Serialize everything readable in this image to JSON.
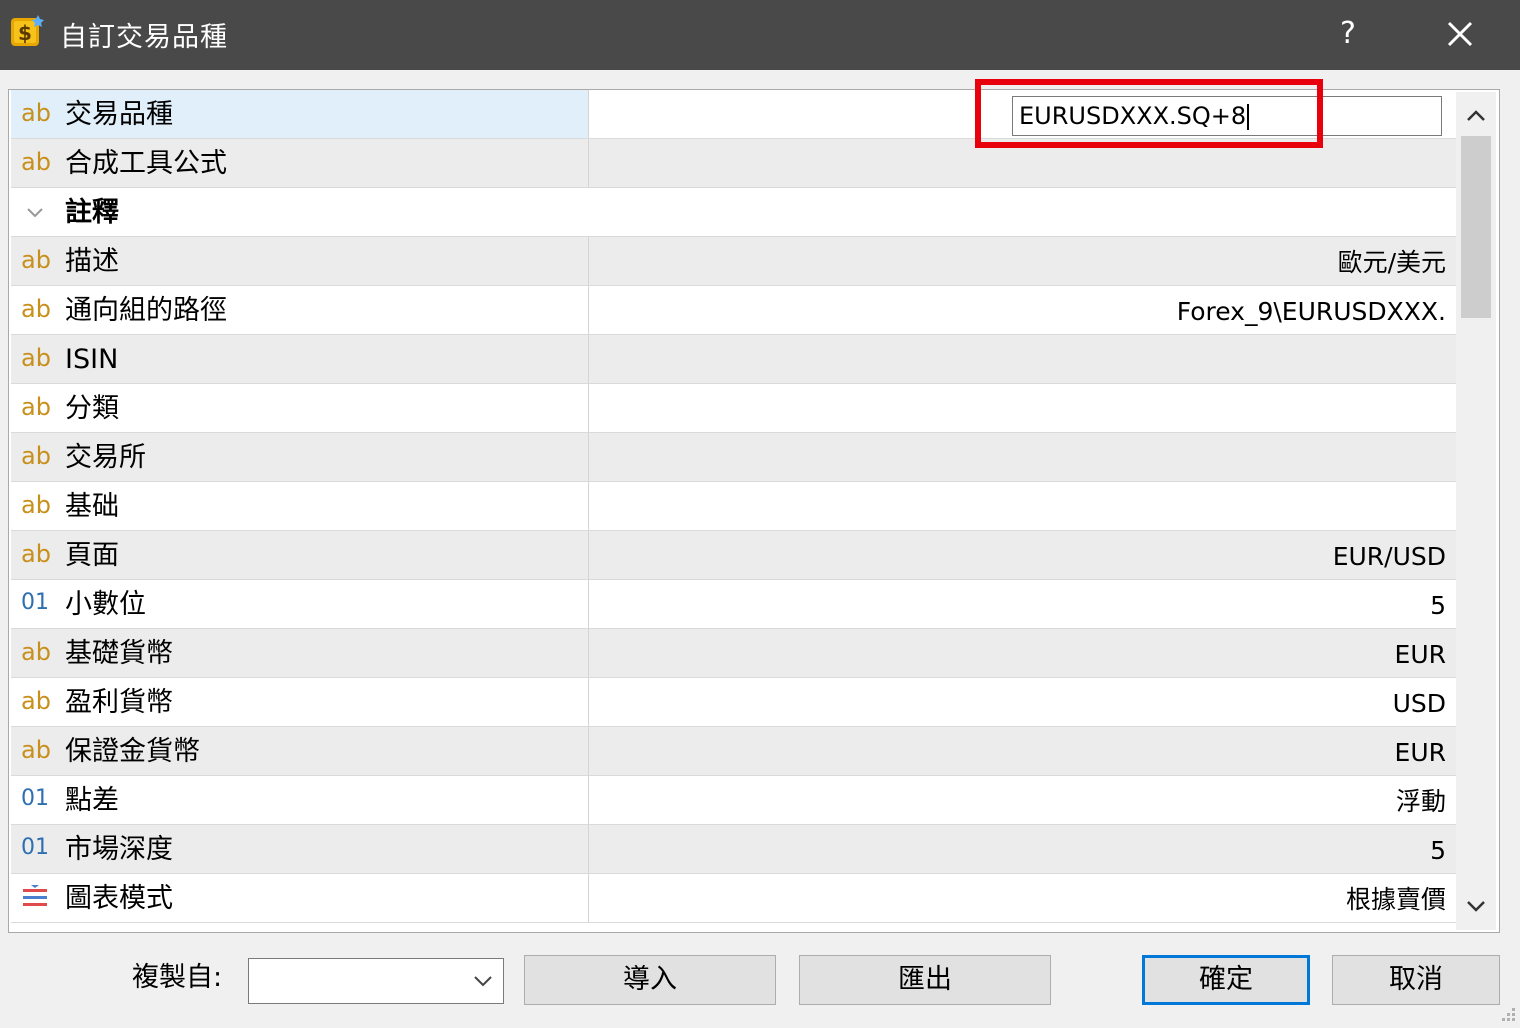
{
  "window": {
    "title": "自訂交易品種",
    "help_label": "?"
  },
  "editor": {
    "value": "EURUSDXXX.SQ+8"
  },
  "properties": [
    {
      "type": "ab",
      "label": "交易品種",
      "value": ""
    },
    {
      "type": "ab",
      "label": "合成工具公式",
      "value": ""
    },
    {
      "type": "section",
      "label": "註釋",
      "value": ""
    },
    {
      "type": "ab",
      "label": "描述",
      "value": "歐元/美元"
    },
    {
      "type": "ab",
      "label": "通向組的路徑",
      "value": "Forex_9\\EURUSDXXX."
    },
    {
      "type": "ab",
      "label": "ISIN",
      "value": ""
    },
    {
      "type": "ab",
      "label": "分類",
      "value": ""
    },
    {
      "type": "ab",
      "label": "交易所",
      "value": ""
    },
    {
      "type": "ab",
      "label": "基础",
      "value": ""
    },
    {
      "type": "ab",
      "label": "頁面",
      "value": "EUR/USD"
    },
    {
      "type": "num",
      "label": "小數位",
      "value": "5"
    },
    {
      "type": "ab",
      "label": "基礎貨幣",
      "value": "EUR"
    },
    {
      "type": "ab",
      "label": "盈利貨幣",
      "value": "USD"
    },
    {
      "type": "ab",
      "label": "保證金貨幣",
      "value": "EUR"
    },
    {
      "type": "num",
      "label": "點差",
      "value": "浮動"
    },
    {
      "type": "num",
      "label": "市場深度",
      "value": "5"
    },
    {
      "type": "list",
      "label": "圖表模式",
      "value": "根據賣價"
    }
  ],
  "type_icons": {
    "ab": "ab",
    "num": "01"
  },
  "footer": {
    "copy_from_label": "複製自:",
    "copy_from_value": "",
    "import_label": "導入",
    "export_label": "匯出",
    "ok_label": "確定",
    "cancel_label": "取消"
  },
  "colors": {
    "highlight": "#e8000d",
    "titlebar": "#494949",
    "default_button_border": "#0078d7"
  }
}
